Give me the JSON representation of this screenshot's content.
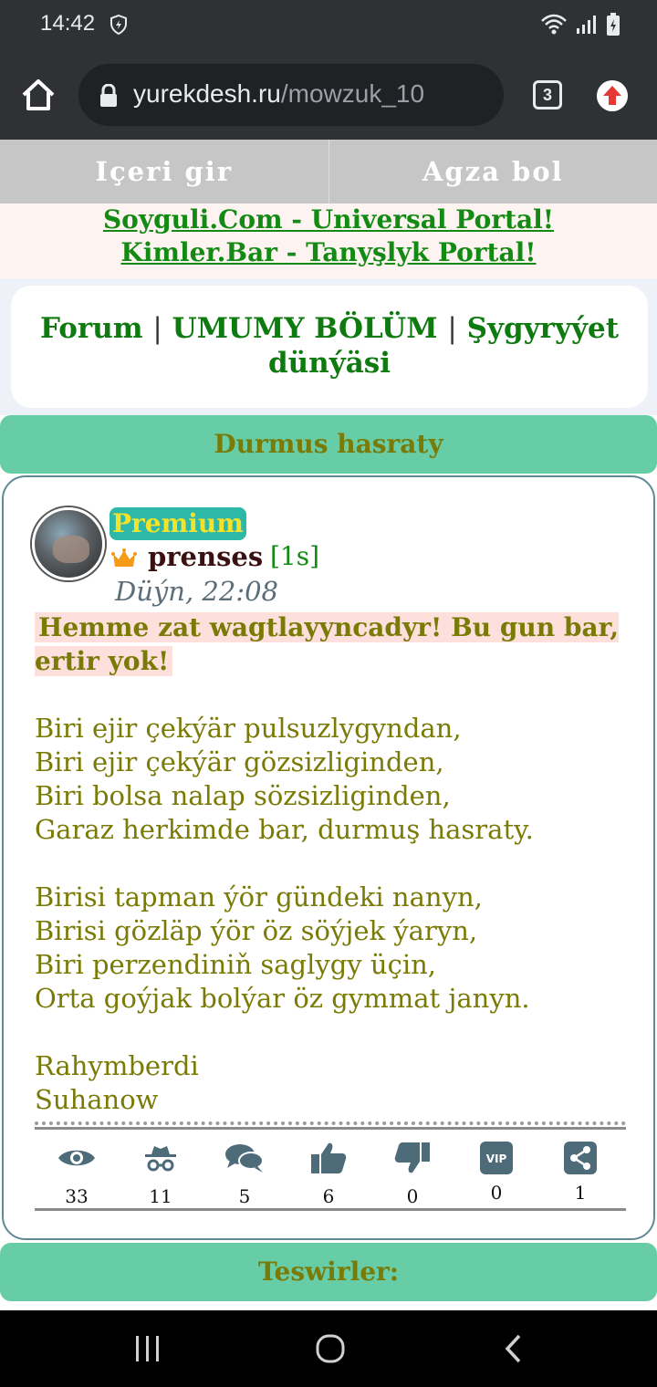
{
  "status_bar": {
    "time": "14:42"
  },
  "browser": {
    "url_domain": "yurekdesh.ru",
    "url_path": "/mowzuk_10",
    "tab_count": "3"
  },
  "login": {
    "login_label": "Içeri gir",
    "register_label": "Agza bol"
  },
  "portals": {
    "link1": "Soyguli.Com - Universal Portal!",
    "link2": "Kimler.Bar - Tanyşlyk Portal!"
  },
  "breadcrumb": {
    "forum": "Forum",
    "section": "UMUMY BÖLÜM",
    "subsection": "Şygyryýet dünýäsi",
    "separator": "|"
  },
  "topic": {
    "title": "Durmus hasraty"
  },
  "post": {
    "badge": "Premium",
    "username": "prenses",
    "rank": "[1s]",
    "time": "Düýn, 22:08",
    "headline": "Hemme zat wagtlayyncadyr! Bu gun bar, ertir yok!",
    "body": "Biri ejir çekýär pulsuzlygyndan,\nBiri ejir çekýär gözsizliginden,\nBiri bolsa nalap sözsizliginden,\nGaraz herkimde bar, durmuş hasraty.\n\nBirisi tapman ýör gündeki nanyn,\nBirisi gözläp ýör öz söýjek ýaryn,\nBiri perzendiniň saglygy üçin,\nOrta goýjak bolýar öz gymmat janyn.\n\nRahymberdi\nSuhanow"
  },
  "stats": {
    "views": "33",
    "guests": "11",
    "comments": "5",
    "likes": "6",
    "dislikes": "0",
    "vip": "0",
    "shares": "1",
    "vip_label": "VIP"
  },
  "comments": {
    "title": "Teswirler:"
  },
  "colors": {
    "accent_green": "#66cda6",
    "link_green": "#138a13",
    "olive_text": "#7a7a06",
    "icon_slate": "#4e6b7a"
  }
}
